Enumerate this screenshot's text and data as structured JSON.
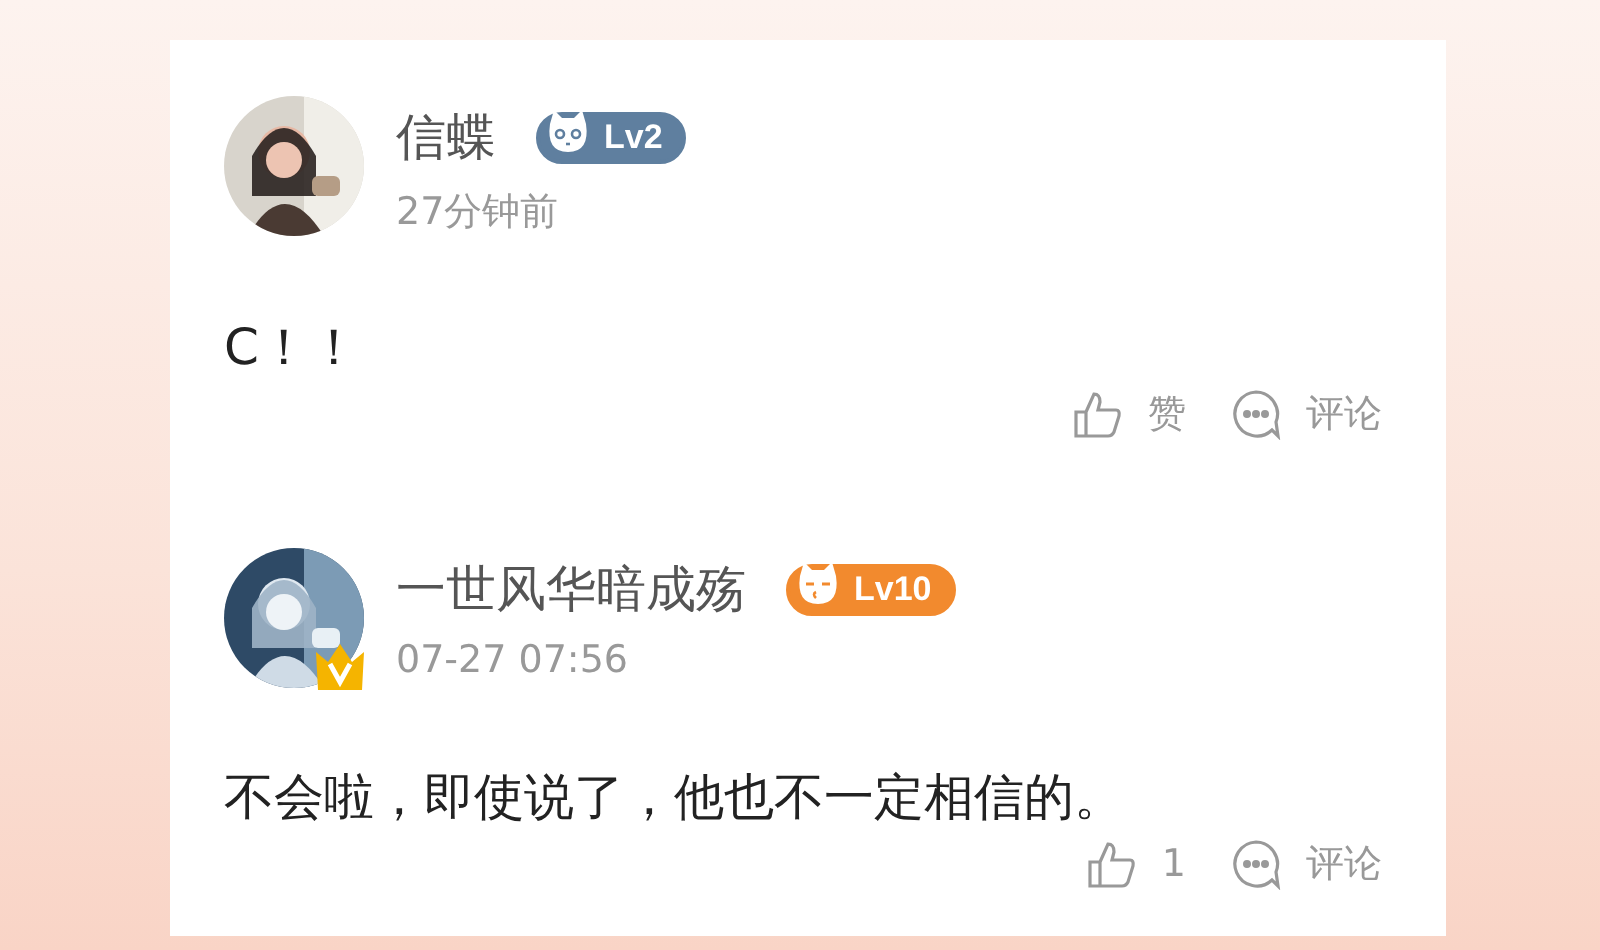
{
  "comments": [
    {
      "name": "信蝶",
      "level": {
        "label": "Lv2",
        "color": "#5f7f9f"
      },
      "vip": false,
      "time": "27分钟前",
      "text": "C！！",
      "likes": "赞",
      "comment_label": "评论"
    },
    {
      "name": "一世风华暗成殇",
      "level": {
        "label": "Lv10",
        "color": "#f28a2e"
      },
      "vip": true,
      "time": "07-27 07:56",
      "text": "不会啦，即使说了，他也不一定相信的。",
      "likes": "1",
      "comment_label": "评论"
    }
  ]
}
